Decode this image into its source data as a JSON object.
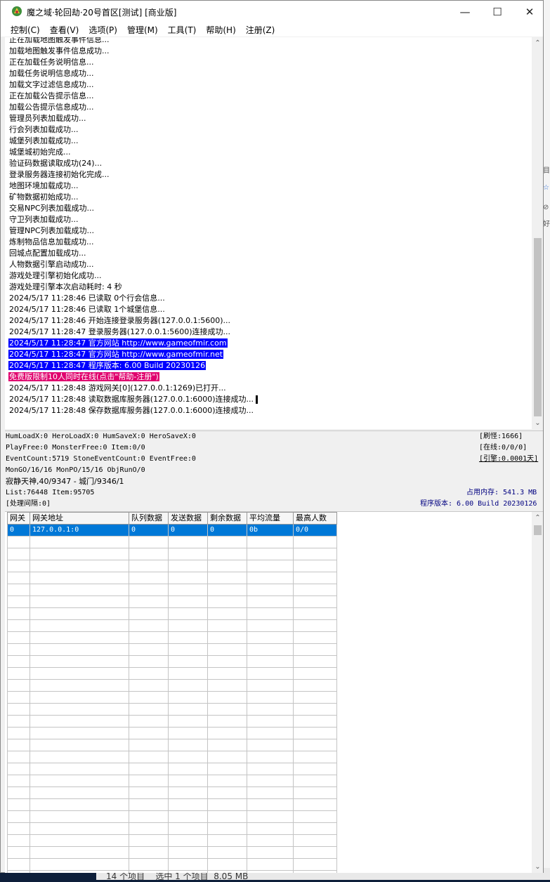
{
  "window": {
    "title": "魔之域·轮回劫·20号首区[测试] [商业版]",
    "icon": "app-game-icon",
    "controls": {
      "minimize": "—",
      "maximize": "☐",
      "close": "✕"
    }
  },
  "menu": [
    "控制(C)",
    "查看(V)",
    "选项(P)",
    "管理(M)",
    "工具(T)",
    "帮助(H)",
    "注册(Z)"
  ],
  "log": {
    "lines": [
      {
        "text": "正在加载地图触发事件信息...",
        "style": "normal"
      },
      {
        "text": "加载地图触发事件信息成功...",
        "style": "normal"
      },
      {
        "text": "正在加载任务说明信息...",
        "style": "normal"
      },
      {
        "text": "加载任务说明信息成功...",
        "style": "normal"
      },
      {
        "text": "加载文字过滤信息成功...",
        "style": "normal"
      },
      {
        "text": "正在加载公告提示信息...",
        "style": "normal"
      },
      {
        "text": "加载公告提示信息成功...",
        "style": "normal"
      },
      {
        "text": "管理员列表加载成功...",
        "style": "normal"
      },
      {
        "text": "行会列表加载成功...",
        "style": "normal"
      },
      {
        "text": "城堡列表加载成功...",
        "style": "normal"
      },
      {
        "text": "城堡城初始完成...",
        "style": "normal"
      },
      {
        "text": "验证码数据读取成功(24)...",
        "style": "normal"
      },
      {
        "text": "登录服务器连接初始化完成...",
        "style": "normal"
      },
      {
        "text": "地图环境加载成功...",
        "style": "normal"
      },
      {
        "text": "矿物数据初始成功...",
        "style": "normal"
      },
      {
        "text": "交易NPC列表加载成功...",
        "style": "normal"
      },
      {
        "text": "守卫列表加载成功...",
        "style": "normal"
      },
      {
        "text": "管理NPC列表加载成功...",
        "style": "normal"
      },
      {
        "text": "炼制物品信息加载成功...",
        "style": "normal"
      },
      {
        "text": "回城点配置加载成功...",
        "style": "normal"
      },
      {
        "text": "人物数据引擎启动成功...",
        "style": "normal"
      },
      {
        "text": "游戏处理引擎初始化成功...",
        "style": "normal"
      },
      {
        "text": "游戏处理引擎本次启动耗时: 4 秒",
        "style": "normal"
      },
      {
        "text": "2024/5/17 11:28:46 已读取 0个行会信息...",
        "style": "normal"
      },
      {
        "text": "2024/5/17 11:28:46 已读取 1个城堡信息...",
        "style": "normal"
      },
      {
        "text": "2024/5/17 11:28:46 开始连接登录服务器(127.0.0.1:5600)...",
        "style": "normal"
      },
      {
        "text": "2024/5/17 11:28:47 登录服务器(127.0.0.1:5600)连接成功...",
        "style": "normal"
      },
      {
        "text": "2024/5/17 11:28:47 官方网站 http://www.gameofmir.com",
        "style": "hl-blue"
      },
      {
        "text": "2024/5/17 11:28:47 官方网站 http://www.gameofmir.net",
        "style": "hl-blue"
      },
      {
        "text": "2024/5/17 11:28:47 程序版本: 6.00 Build 20230126",
        "style": "hl-blue"
      },
      {
        "text": "免费版限制10人同时在线(点击\"帮助-注册\")",
        "style": "hl-pink"
      },
      {
        "text": "2024/5/17 11:28:48 游戏网关[0](127.0.0.1:1269)已打开...",
        "style": "normal"
      },
      {
        "text": "2024/5/17 11:28:48 读取数据库服务器(127.0.0.1:6000)连接成功...",
        "style": "caret"
      },
      {
        "text": "2024/5/17 11:28:48 保存数据库服务器(127.0.0.1:6000)连接成功...",
        "style": "normal"
      }
    ]
  },
  "status": {
    "line1": "HumLoadX:0 HeroLoadX:0 HumSaveX:0 HeroSaveX:0",
    "line2": "PlayFree:0 MonsterFree:0 Item:0/0",
    "line3": "EventCount:5719 StoneEventCount:0 EventFree:0",
    "line4": "MonGO/16/16 MonPO/15/16 ObjRunO/0",
    "line5": "寂静天神,40/9347 - 城门/9346/1",
    "line6": "List:76448 Item:95705",
    "line7": "[处理间隔:0]",
    "refresh": "[刷怪:1666]",
    "online": "[在线:0/0/0]",
    "engine": "[引擎:0.0001天]",
    "memory": "占用内存: 541.3 MB",
    "version": "程序版本: 6.00 Build 20230126"
  },
  "gateway_table": {
    "columns": [
      "网关",
      "网关地址",
      "队列数据",
      "发送数据",
      "剩余数据",
      "平均流量",
      "最高人数"
    ],
    "rows": [
      [
        "0",
        "127.0.0.1:0",
        "0",
        "0",
        "0",
        "0b",
        "0/0"
      ]
    ],
    "empty_rows": 29
  },
  "desktop": {
    "right_fragments": [
      "目",
      "☆",
      "⊘",
      "好"
    ],
    "bottom_text": "14 个项目    选中 1 个项目  8.05 MB"
  }
}
